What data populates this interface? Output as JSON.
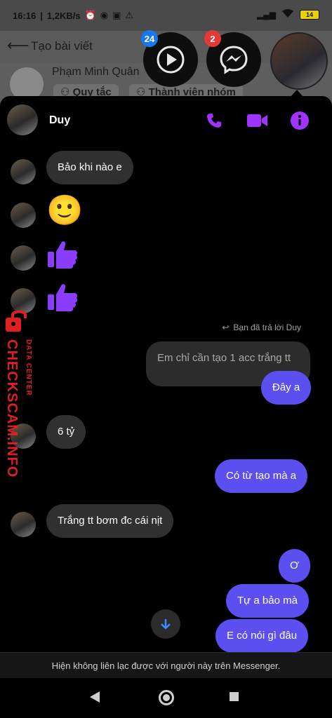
{
  "status_bar": {
    "time": "16:16",
    "speed": "1,2KB/s",
    "battery": "14"
  },
  "facebook": {
    "back_icon": "arrow-left-icon",
    "title": "Tạo bài viết",
    "author": "Phạm Minh Quân",
    "chip_rules": "Quy tắc",
    "chip_members": "Thành viên nhóm"
  },
  "chat_heads": {
    "video_badge": "24",
    "messenger_badge": "2"
  },
  "chat": {
    "contact_name": "Duy",
    "icons": {
      "call": "phone-icon",
      "video": "video-camera-icon",
      "info": "info-icon"
    },
    "accent_color": "#a033ff",
    "messages": [
      {
        "from": "them",
        "text": "Bảo khi nào e"
      },
      {
        "from": "them",
        "emoji": "🙂"
      },
      {
        "from": "them",
        "emoji": "👍"
      },
      {
        "from": "them",
        "emoji": "👍"
      },
      {
        "from": "me",
        "reply_note": "Bạn đã trả lời Duy",
        "quoted": "Em chỉ cần tạo 1 acc trắng tt",
        "text": "Đây a"
      },
      {
        "from": "them",
        "text": "6 tỷ"
      },
      {
        "from": "me",
        "text": "Có từ tạo mà a"
      },
      {
        "from": "them",
        "text": "Trắng tt bơm đc cái nịt"
      },
      {
        "from": "me",
        "text": "Ơ"
      },
      {
        "from": "me",
        "text": "Tự a bảo mà"
      },
      {
        "from": "me",
        "text": "E có nói gì đâu"
      }
    ],
    "notice": "Hiện không liên lạc được với người này trên Messenger."
  },
  "watermark": {
    "brand": "CHECKSCAM.INFO",
    "subtitle": "DATA CENTER"
  }
}
